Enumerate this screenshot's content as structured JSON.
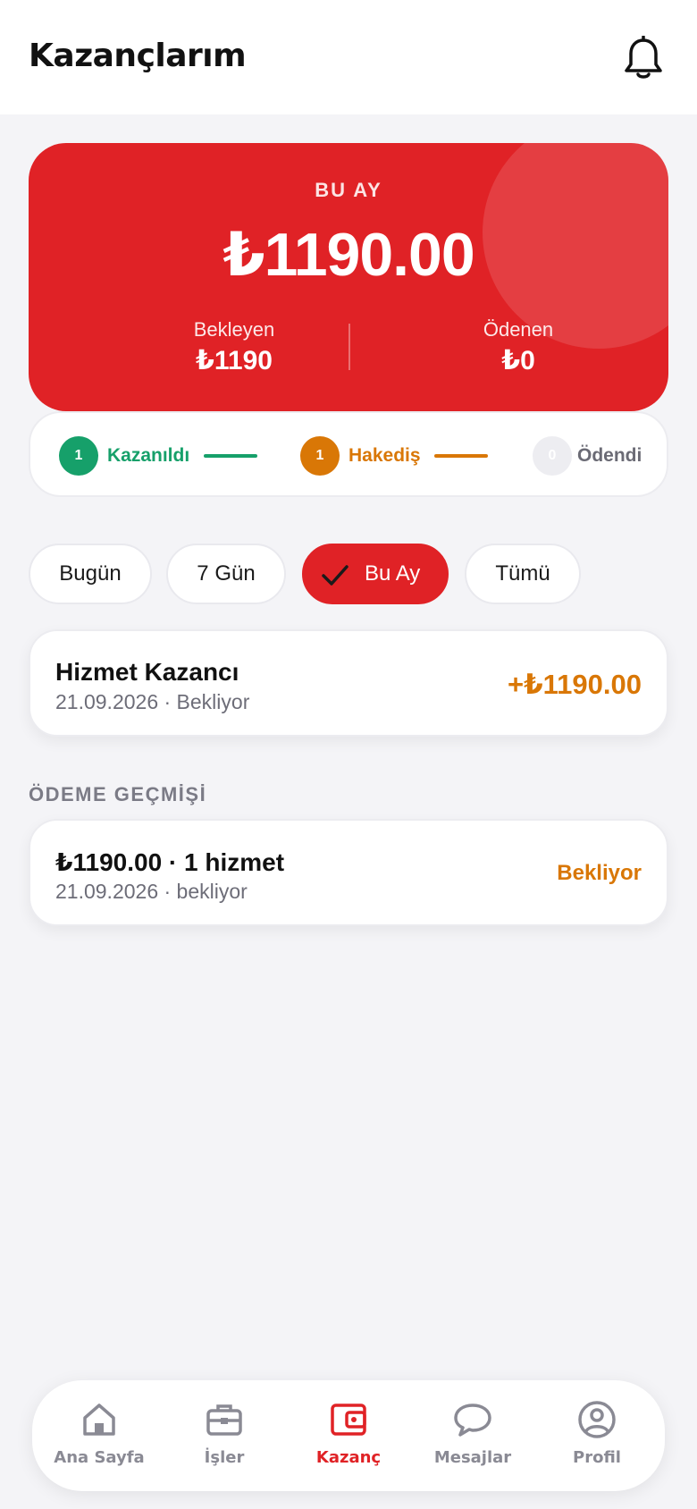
{
  "header": {
    "title": "Kazançlarım",
    "bell_icon": "bell-icon"
  },
  "summary": {
    "period_label": "BU AY",
    "total": "₺1190.00",
    "pending_label": "Bekleyen",
    "pending_value": "₺1190",
    "paid_label": "Ödenen",
    "paid_value": "₺0"
  },
  "steps": [
    {
      "count": "1",
      "label": "Kazanıldı",
      "color": "#16a06a"
    },
    {
      "count": "1",
      "label": "Hakediş",
      "color": "#d97706"
    },
    {
      "count": "0",
      "label": "Ödendi",
      "color": "#6b6b75"
    }
  ],
  "filters": [
    {
      "label": "Bugün",
      "active": false
    },
    {
      "label": "7 Gün",
      "active": false
    },
    {
      "label": "Bu Ay",
      "active": true
    },
    {
      "label": "Tümü",
      "active": false
    }
  ],
  "earnings": [
    {
      "title": "Hizmet Kazancı",
      "subtitle": "21.09.2026 · Bekliyor",
      "amount": "+₺1190.00"
    }
  ],
  "payment_history": {
    "title": "ÖDEME GEÇMİŞİ",
    "items": [
      {
        "title": "₺1190.00 · 1 hizmet",
        "subtitle": "21.09.2026 · bekliyor",
        "status": "Bekliyor"
      }
    ]
  },
  "nav": {
    "items": [
      {
        "label": "Ana Sayfa",
        "icon": "home-icon"
      },
      {
        "label": "İşler",
        "icon": "briefcase-icon"
      },
      {
        "label": "Kazanç",
        "icon": "wallet-icon",
        "active": true
      },
      {
        "label": "Mesajlar",
        "icon": "chat-icon"
      },
      {
        "label": "Profil",
        "icon": "profile-icon"
      }
    ]
  },
  "colors": {
    "brand_red": "#e02226",
    "success_green": "#16a06a",
    "warning_orange": "#d97706",
    "background": "#f4f4f7"
  }
}
